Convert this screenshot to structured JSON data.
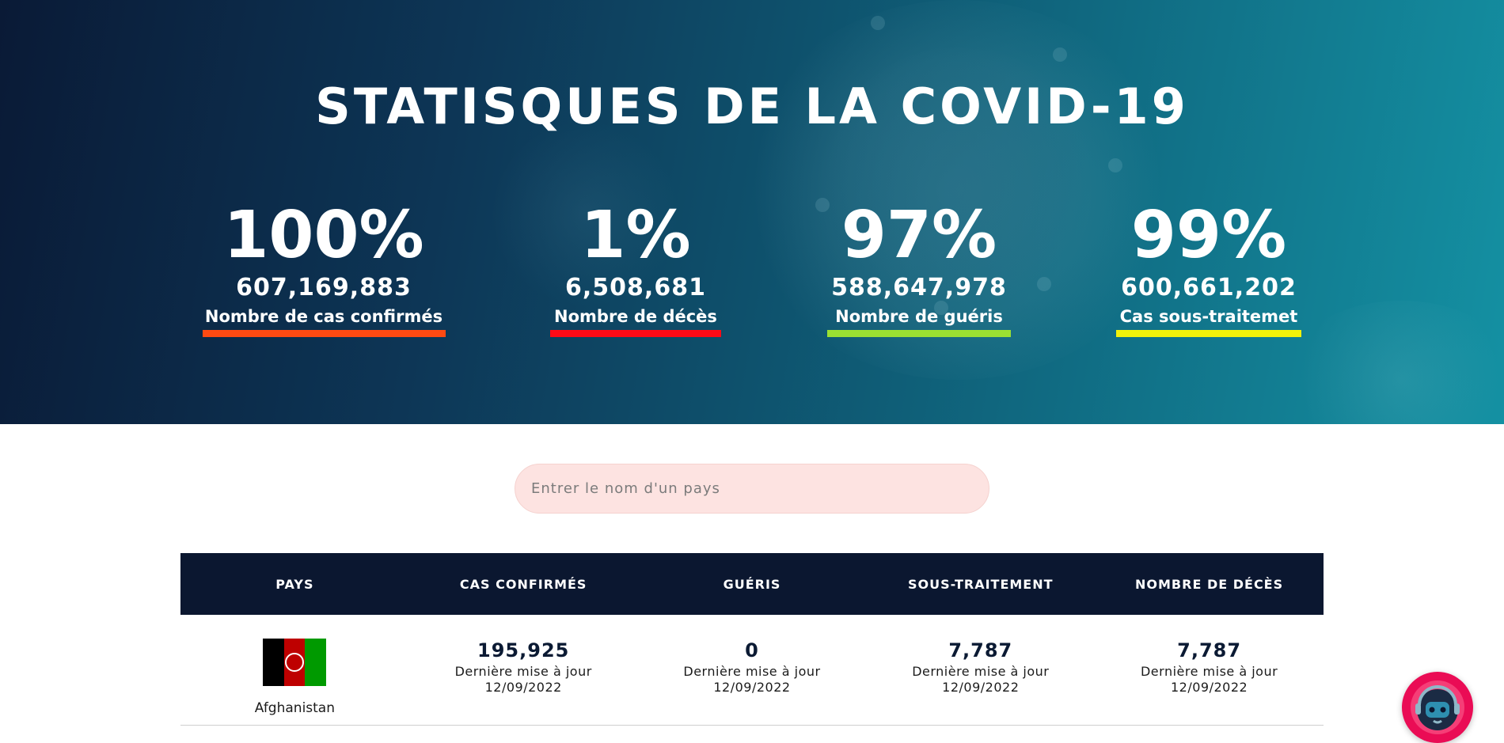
{
  "hero": {
    "title": "STATISQUES DE LA COVID-19",
    "stats": [
      {
        "percent": "100%",
        "count": "607,169,883",
        "label": "Nombre de cas confirmés",
        "color": "#ff4a12"
      },
      {
        "percent": "1%",
        "count": "6,508,681",
        "label": "Nombre de décès",
        "color": "#ff0a16"
      },
      {
        "percent": "97%",
        "count": "588,647,978",
        "label": "Nombre de guéris",
        "color": "#9be032"
      },
      {
        "percent": "99%",
        "count": "600,661,202",
        "label": "Cas sous-traitemet",
        "color": "#f2f20a"
      }
    ]
  },
  "search": {
    "placeholder": "Entrer le nom d'un pays",
    "value": ""
  },
  "table": {
    "headers": [
      "PAYS",
      "CAS CONFIRMÉS",
      "GUÉRIS",
      "SOUS-TRAITEMENT",
      "NOMBRE DE DÉCÈS"
    ],
    "rows": [
      {
        "country": "Afghanistan",
        "flag_colors": [
          "#000000",
          "#be0000",
          "#009a00"
        ],
        "cells": [
          {
            "value": "195,925",
            "update_label": "Dernière mise à jour",
            "update_date": "12/09/2022"
          },
          {
            "value": "0",
            "update_label": "Dernière mise à jour",
            "update_date": "12/09/2022"
          },
          {
            "value": "7,787",
            "update_label": "Dernière mise à jour",
            "update_date": "12/09/2022"
          },
          {
            "value": "7,787",
            "update_label": "Dernière mise à jour",
            "update_date": "12/09/2022"
          }
        ]
      }
    ]
  },
  "chatbot": {
    "icon": "robot-icon",
    "color": "#ea0c55"
  }
}
